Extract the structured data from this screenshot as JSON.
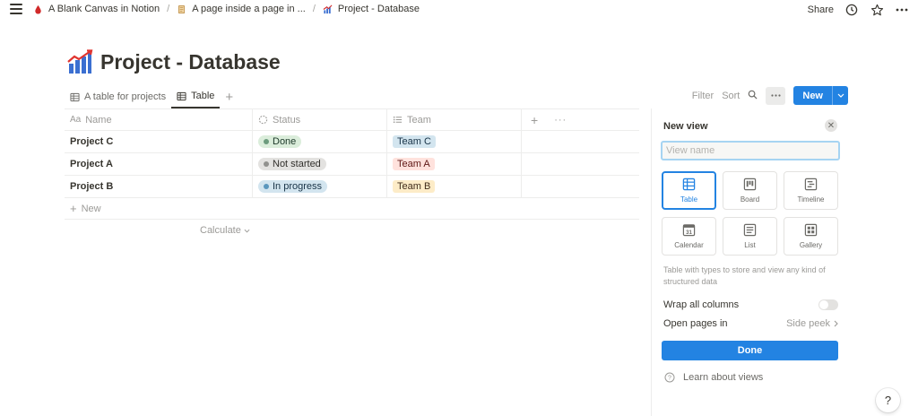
{
  "topbar": {
    "breadcrumbs": [
      {
        "label": "A Blank Canvas in Notion",
        "icon": "blood-drop-icon"
      },
      {
        "label": "A page inside a page in ...",
        "icon": "scroll-icon"
      },
      {
        "label": "Project - Database",
        "icon": "chart-icon"
      }
    ],
    "share_label": "Share"
  },
  "page": {
    "title": "Project - Database",
    "icon": "chart-increasing-icon"
  },
  "views": {
    "tabs": [
      {
        "label": "A table for projects",
        "active": false
      },
      {
        "label": "Table",
        "active": true
      }
    ],
    "filter_label": "Filter",
    "sort_label": "Sort",
    "new_label": "New"
  },
  "table": {
    "columns": [
      "Name",
      "Status",
      "Team"
    ],
    "rows": [
      {
        "name": "Project C",
        "status": "Done",
        "team": "Team C"
      },
      {
        "name": "Project A",
        "status": "Not started",
        "team": "Team A"
      },
      {
        "name": "Project B",
        "status": "In progress",
        "team": "Team B"
      }
    ],
    "new_row_label": "New",
    "calculate_label": "Calculate"
  },
  "colors": {
    "accent": "#2383e2",
    "status_done_bg": "#dbeddb",
    "status_done_dot": "#6c9b7d",
    "status_not_started_bg": "#e3e2e0",
    "status_not_started_dot": "#91918e",
    "status_in_progress_bg": "#d3e5ef",
    "status_in_progress_dot": "#5b97bd",
    "team_c_bg": "#d3e5ef",
    "team_a_bg": "#ffe2dd",
    "team_b_bg": "#fdecc8"
  },
  "panel": {
    "title": "New view",
    "input_placeholder": "View name",
    "layouts": [
      {
        "label": "Table",
        "icon": "table-icon",
        "selected": true
      },
      {
        "label": "Board",
        "icon": "board-icon",
        "selected": false
      },
      {
        "label": "Timeline",
        "icon": "timeline-icon",
        "selected": false
      },
      {
        "label": "Calendar",
        "icon": "calendar-icon",
        "selected": false
      },
      {
        "label": "List",
        "icon": "list-icon",
        "selected": false
      },
      {
        "label": "Gallery",
        "icon": "gallery-icon",
        "selected": false
      }
    ],
    "calendar_day": "31",
    "description": "Table with types to store and view any kind of structured data",
    "wrap_label": "Wrap all columns",
    "open_pages_label": "Open pages in",
    "open_pages_value": "Side peek",
    "done_label": "Done",
    "learn_label": "Learn about views"
  },
  "help_label": "?"
}
